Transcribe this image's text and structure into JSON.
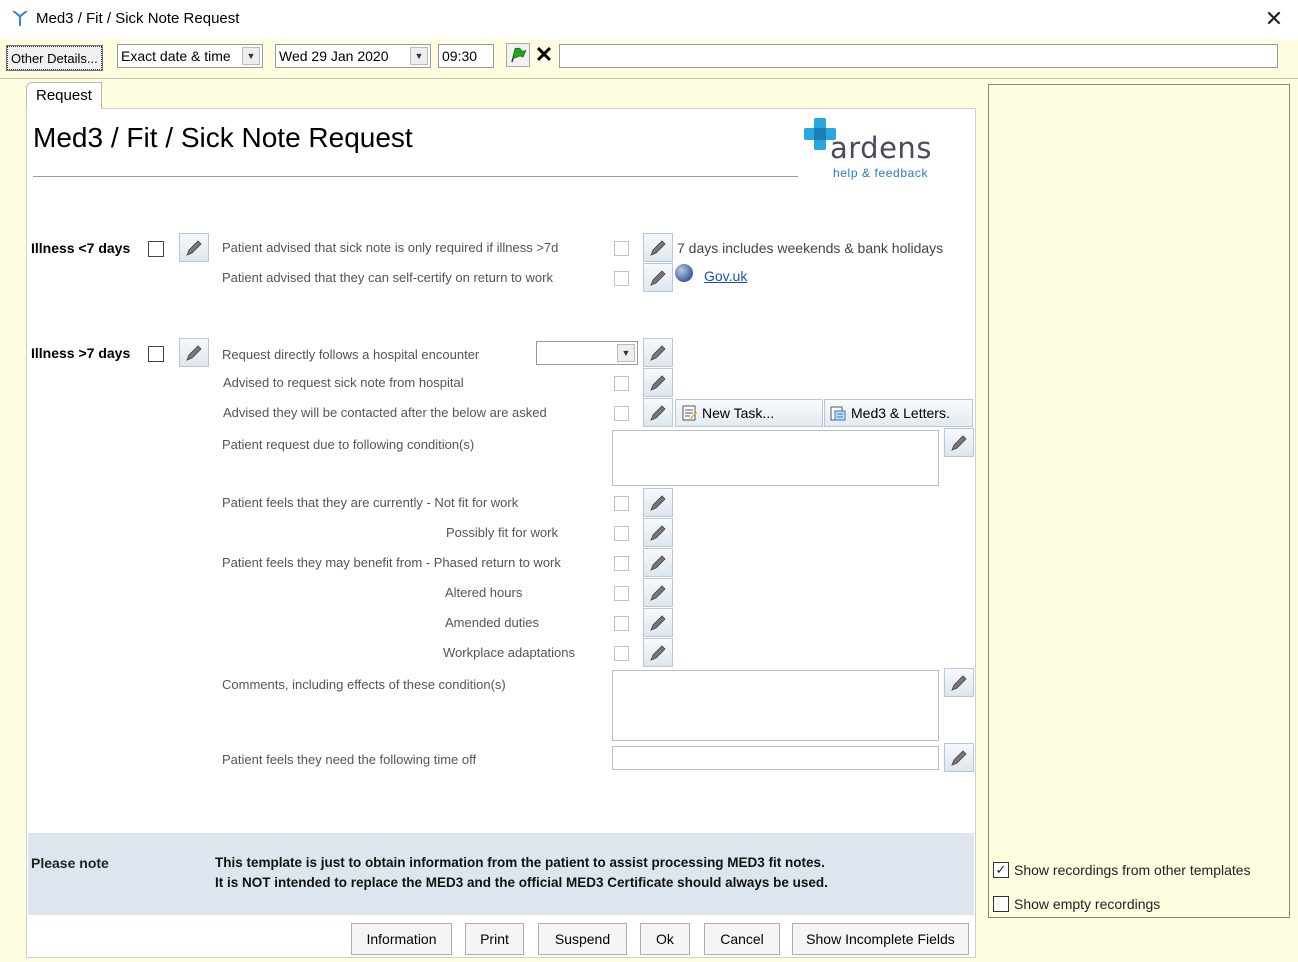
{
  "window": {
    "title": "Med3 / Fit / Sick Note Request"
  },
  "toolbar": {
    "other_details": "Other Details...",
    "date_mode": "Exact date & time",
    "date": "Wed 29 Jan 2020",
    "time": "09:30"
  },
  "tab": {
    "label": "Request"
  },
  "page": {
    "title": "Med3 / Fit / Sick Note Request"
  },
  "logo": {
    "name": "ardens",
    "help": "help & feedback"
  },
  "illness_short": {
    "label": "Illness <7 days",
    "rows": [
      "Patient advised that sick note is only required if illness >7d",
      "Patient advised that they can self-certify on return to work"
    ],
    "info_text": "7 days includes weekends & bank holidays",
    "link_text": "Gov.uk"
  },
  "illness_long": {
    "label": "Illness >7 days",
    "hospital": "Request directly follows a hospital encounter",
    "advised_hospital": "Advised to request sick note from hospital",
    "advised_contact": "Advised they will be contacted after the below are asked",
    "new_task": "New Task...",
    "med3_letters": "Med3 & Letters.",
    "condition": "Patient request due to following condition(s)",
    "not_fit": "Patient feels that they are currently - Not fit for work",
    "possibly_fit": "Possibly fit for work",
    "phased": "Patient feels they may benefit from - Phased return to work",
    "altered_hours": "Altered hours",
    "amended_duties": "Amended duties",
    "workplace": "Workplace adaptations",
    "comments": "Comments, including effects of these condition(s)",
    "time_off": "Patient feels they need the following time off"
  },
  "note": {
    "label": "Please note",
    "line1": "This template is just to obtain information from the patient to assist processing MED3 fit notes.",
    "line2": "It is NOT intended to replace the MED3 and the official MED3 Certificate should always be used."
  },
  "footer": {
    "information": "Information",
    "print": "Print",
    "suspend": "Suspend",
    "ok": "Ok",
    "cancel": "Cancel",
    "show_incomplete": "Show Incomplete Fields"
  },
  "side": {
    "show_other": {
      "label": "Show recordings from other templates",
      "checked": true
    },
    "show_empty": {
      "label": "Show empty recordings",
      "checked": false
    }
  },
  "colors": {
    "accent": "#2a79c4",
    "logo_cross": "#2aa6df",
    "note_band": "#dde6ef",
    "panel_bg": "#fffde0"
  }
}
